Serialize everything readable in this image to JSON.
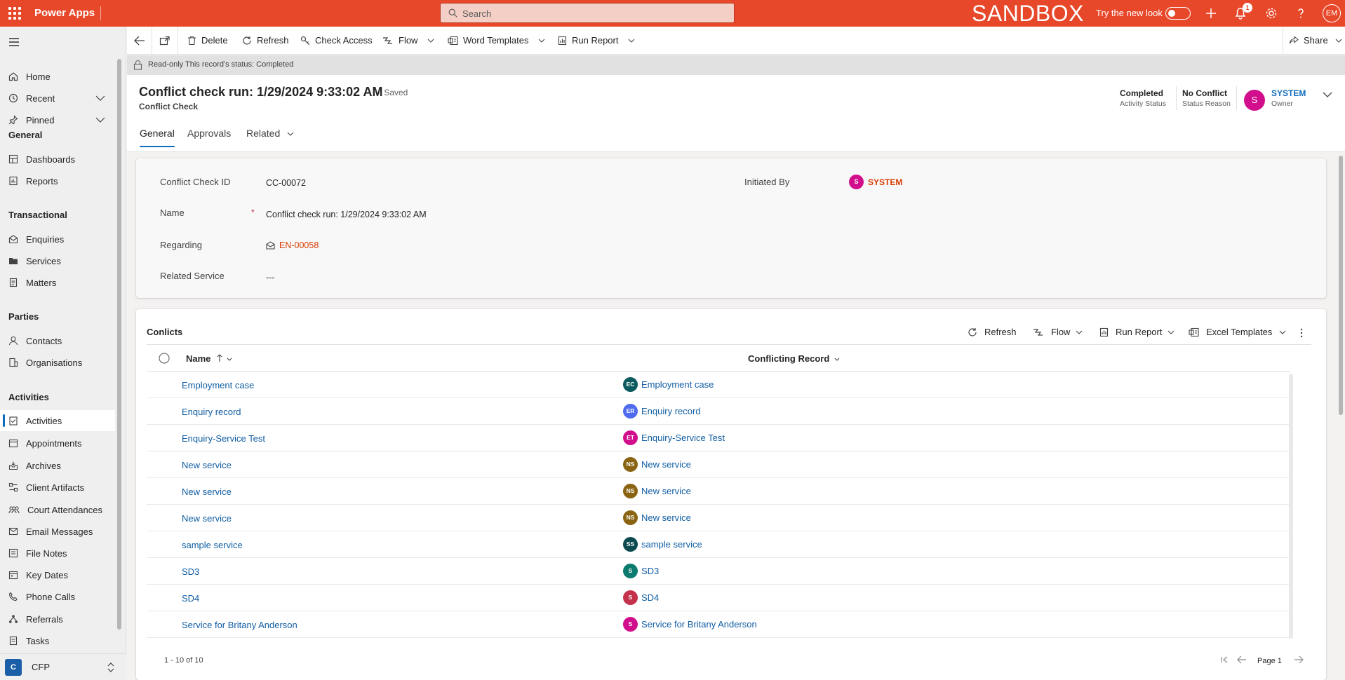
{
  "topbar": {
    "app_name": "Power Apps",
    "search_placeholder": "Search",
    "environment": "SANDBOX",
    "try_new_look": "Try the new look",
    "notification_count": "1",
    "user_initials": "EM"
  },
  "sidebar": {
    "home": "Home",
    "recent": "Recent",
    "pinned": "Pinned",
    "groups": {
      "general": "General",
      "transactional": "Transactional",
      "parties": "Parties",
      "activities": "Activities"
    },
    "general_items": [
      "Dashboards",
      "Reports"
    ],
    "transactional_items": [
      "Enquiries",
      "Services",
      "Matters"
    ],
    "parties_items": [
      "Contacts",
      "Organisations"
    ],
    "activities_items": [
      "Activities",
      "Appointments",
      "Archives",
      "Client Artifacts",
      "Court Attendances",
      "Email Messages",
      "File Notes",
      "Key Dates",
      "Phone Calls",
      "Referrals",
      "Tasks"
    ],
    "area_badge": "C",
    "area_name": "CFP"
  },
  "commands": {
    "delete": "Delete",
    "refresh": "Refresh",
    "check_access": "Check Access",
    "flow": "Flow",
    "word_templates": "Word Templates",
    "run_report": "Run Report",
    "share": "Share"
  },
  "readonly_notice": "Read-only This record's status: Completed",
  "header": {
    "title": "Conflict check run: 1/29/2024 9:33:02 AM",
    "saved": "- Saved",
    "entity": "Conflict Check",
    "activity_status_value": "Completed",
    "activity_status_label": "Activity Status",
    "status_reason_value": "No Conflict",
    "status_reason_label": "Status Reason",
    "owner_initial": "S",
    "owner_name": "SYSTEM",
    "owner_label": "Owner"
  },
  "tabs": [
    "General",
    "Approvals",
    "Related"
  ],
  "form": {
    "conflict_check_id_label": "Conflict Check ID",
    "conflict_check_id_value": "CC-00072",
    "name_label": "Name",
    "name_required": "*",
    "name_value": "Conflict check run: 1/29/2024 9:33:02 AM",
    "regarding_label": "Regarding",
    "regarding_value": "EN-00058",
    "related_service_label": "Related Service",
    "related_service_value": "---",
    "initiated_by_label": "Initiated By",
    "initiated_by_initial": "S",
    "initiated_by_value": "SYSTEM"
  },
  "grid": {
    "title": "Conlicts",
    "refresh": "Refresh",
    "flow": "Flow",
    "run_report": "Run Report",
    "excel_templates": "Excel Templates",
    "col_name": "Name",
    "col_conflicting": "Conflicting Record",
    "rows": [
      {
        "name": "Employment case",
        "initials": "EC",
        "color": "#0b5a5f",
        "record": "Employment case"
      },
      {
        "name": "Enquiry record",
        "initials": "ER",
        "color": "#4f6bed",
        "record": "Enquiry record"
      },
      {
        "name": "Enquiry-Service Test",
        "initials": "ET",
        "color": "#d10f8c",
        "record": "Enquiry-Service Test"
      },
      {
        "name": "New service",
        "initials": "NS",
        "color": "#8a6412",
        "record": "New service"
      },
      {
        "name": "New service",
        "initials": "NS",
        "color": "#8a6412",
        "record": "New service"
      },
      {
        "name": "New service",
        "initials": "NS",
        "color": "#8a6412",
        "record": "New service"
      },
      {
        "name": "sample service",
        "initials": "SS",
        "color": "#0b4a4f",
        "record": "sample service"
      },
      {
        "name": "SD3",
        "initials": "S",
        "color": "#0b7a6f",
        "record": "SD3"
      },
      {
        "name": "SD4",
        "initials": "S",
        "color": "#c4314b",
        "record": "SD4"
      },
      {
        "name": "Service for Britany Anderson",
        "initials": "S",
        "color": "#d10f8c",
        "record": "Service for Britany Anderson"
      }
    ],
    "footer_count": "1 - 10 of 10",
    "page_label": "Page 1"
  }
}
